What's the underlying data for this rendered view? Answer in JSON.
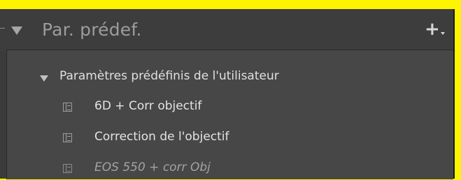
{
  "panel": {
    "title": "Par. prédef.",
    "add_button_glyph": "+"
  },
  "folder": {
    "label": "Paramètres prédéfinis de l'utilisateur",
    "expanded": true
  },
  "presets": [
    {
      "label": "6D + Corr objectif",
      "icon": "preset-icon",
      "style": "normal"
    },
    {
      "label": "Correction de l'objectif",
      "icon": "preset-icon",
      "style": "normal"
    },
    {
      "label": "EOS 550 + corr Obj",
      "icon": "preset-icon",
      "style": "italic"
    }
  ],
  "colors": {
    "highlight": "#fdf400",
    "panel_bg": "#3b3b3b",
    "list_bg": "#474747",
    "text": "#e3e3e3",
    "title_text": "#9c9c9c"
  }
}
